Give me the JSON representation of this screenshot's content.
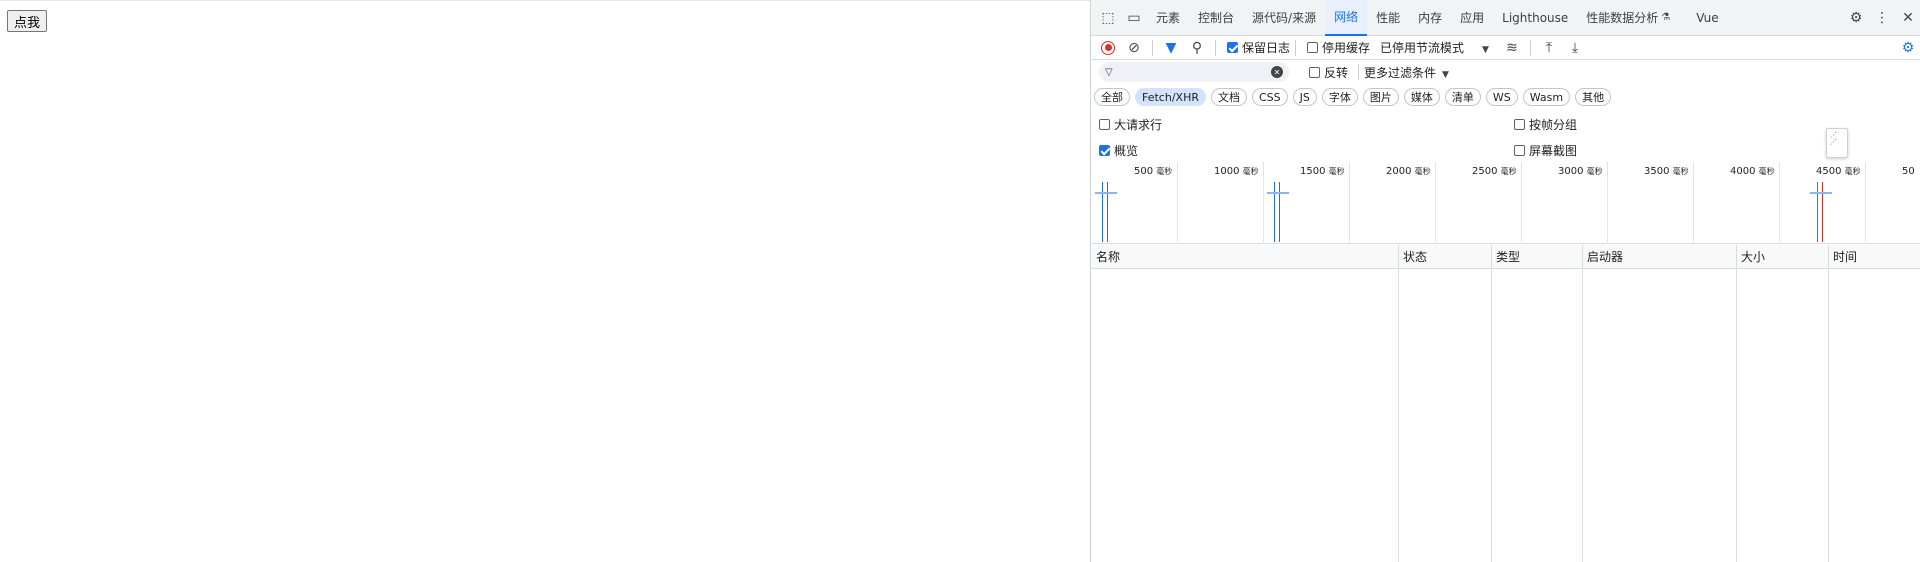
{
  "page": {
    "button_label": "点我"
  },
  "devtools": {
    "tabs": [
      {
        "label": "元素"
      },
      {
        "label": "控制台"
      },
      {
        "label": "源代码/来源"
      },
      {
        "label": "网络"
      },
      {
        "label": "性能"
      },
      {
        "label": "内存"
      },
      {
        "label": "应用"
      },
      {
        "label": "Lighthouse"
      },
      {
        "label": "性能数据分析"
      },
      {
        "label": "Vue"
      }
    ],
    "active_tab": "网络",
    "toolbar": {
      "preserve_log": "保留日志",
      "disable_cache": "停用缓存",
      "throttling": "已停用节流模式"
    },
    "filter": {
      "invert": "反转",
      "more_filters": "更多过滤条件"
    },
    "types": [
      "全部",
      "Fetch/XHR",
      "文档",
      "CSS",
      "JS",
      "字体",
      "图片",
      "媒体",
      "清单",
      "WS",
      "Wasm",
      "其他"
    ],
    "active_type": "Fetch/XHR",
    "options": {
      "big_rows": "大请求行",
      "group_by_frame": "按帧分组",
      "overview": "概览",
      "screenshots": "屏幕截图"
    },
    "timeline": {
      "ticks": [
        {
          "num": "500",
          "unit": "毫秒"
        },
        {
          "num": "1000",
          "unit": "毫秒"
        },
        {
          "num": "1500",
          "unit": "毫秒"
        },
        {
          "num": "2000",
          "unit": "毫秒"
        },
        {
          "num": "2500",
          "unit": "毫秒"
        },
        {
          "num": "3000",
          "unit": "毫秒"
        },
        {
          "num": "3500",
          "unit": "毫秒"
        },
        {
          "num": "4000",
          "unit": "毫秒"
        },
        {
          "num": "4500",
          "unit": "毫秒"
        },
        {
          "num": "50",
          "unit": ""
        }
      ]
    },
    "columns": [
      "名称",
      "状态",
      "类型",
      "启动器",
      "大小",
      "时间"
    ],
    "colors": {
      "accent": "#1a73e8",
      "record": "#d93025"
    }
  }
}
